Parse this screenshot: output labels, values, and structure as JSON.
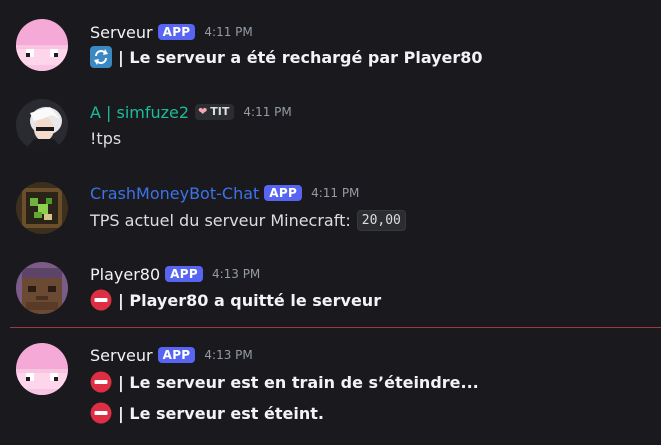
{
  "messages": [
    {
      "author": "Serveur",
      "badge": "APP",
      "time": "4:11 PM",
      "name_color": "#f2f3f5",
      "avatar": "pink-sheep-avatar",
      "lines": [
        {
          "icon": "refresh-icon",
          "text": "| Le serveur a été rechargé par Player80"
        }
      ]
    },
    {
      "author": "A | simfuze2",
      "tag": "TIT",
      "time": "4:11 PM",
      "name_color": "#1abc9c",
      "avatar": "anime-character-avatar",
      "lines": [
        {
          "text": "!tps"
        }
      ]
    },
    {
      "author": "CrashMoneyBot-Chat",
      "badge": "APP",
      "time": "4:11 PM",
      "name_color": "#3c73e8",
      "avatar": "money-block-avatar",
      "lines": [
        {
          "text": "TPS actuel du serveur Minecraft:",
          "code": "20,00"
        }
      ]
    },
    {
      "author": "Player80",
      "badge": "APP",
      "time": "4:13 PM",
      "name_color": "#f2f3f5",
      "avatar": "minecraft-head-avatar",
      "lines": [
        {
          "icon": "no-entry-icon",
          "text": "| Player80 a quitté le serveur"
        }
      ]
    },
    {
      "author": "Serveur",
      "badge": "APP",
      "time": "4:13 PM",
      "name_color": "#f2f3f5",
      "avatar": "pink-sheep-avatar",
      "lines": [
        {
          "icon": "no-entry-icon",
          "text": "| Le serveur est en train de s’éteindre..."
        },
        {
          "icon": "no-entry-icon",
          "text": "| Le serveur est éteint."
        }
      ]
    }
  ],
  "colors": {
    "background": "#1a1a1e",
    "app_badge": "#5865f2",
    "new_messages_divider": "#a1393e"
  }
}
